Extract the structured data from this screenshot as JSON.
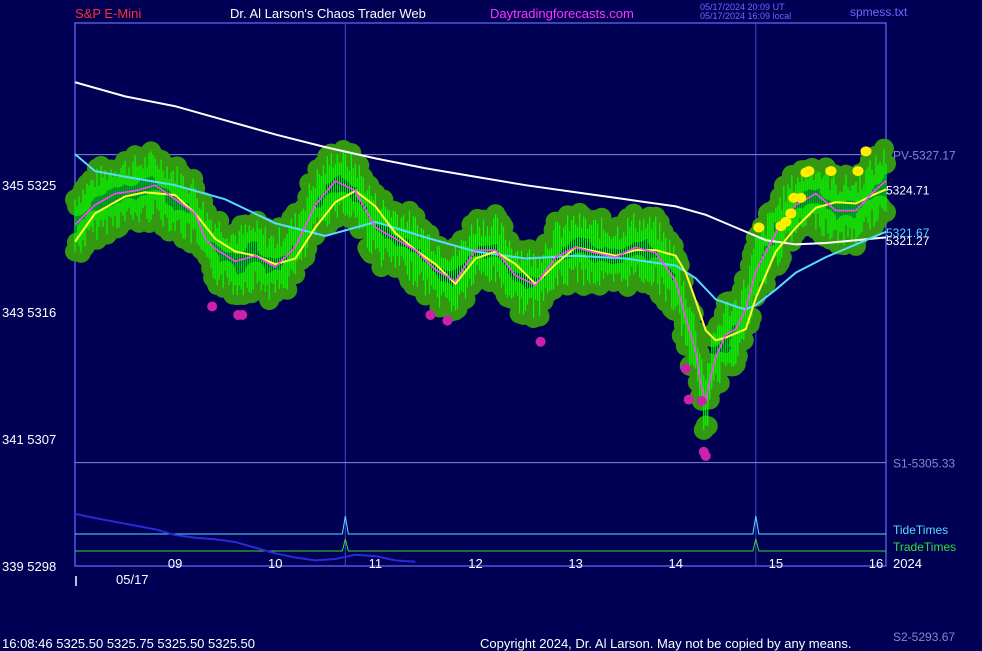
{
  "header": {
    "symbol": "S&P E-Mini",
    "site_title": "Dr. Al Larson's Chaos Trader Web",
    "site_url": "Daytradingforecasts.com",
    "timestamp_ut": "05/17/2024 20:09 UT",
    "timestamp_local": "05/17/2024 16:09 local",
    "file": "spmess.txt"
  },
  "footer": {
    "quote": "16:08:46  5325.50 5325.75 5325.50 5325.50",
    "copyright": "Copyright 2024, Dr. Al Larson. May not be copied by any means.",
    "s2_label": "S2-5293.67"
  },
  "date_label": "05/17",
  "year_label": "2024",
  "chart_data": {
    "type": "line",
    "y_axis_labels": [
      {
        "text": "345  5325",
        "value": 5325
      },
      {
        "text": "343  5316",
        "value": 5316
      },
      {
        "text": "341  5307",
        "value": 5307
      },
      {
        "text": "339  5298",
        "value": 5298
      }
    ],
    "x_ticks": [
      "09",
      "10",
      "11",
      "12",
      "13",
      "14",
      "15",
      "16"
    ],
    "x_tick_values": [
      9,
      10,
      11,
      12,
      13,
      14,
      15,
      16
    ],
    "xlim": [
      8.0,
      16.1
    ],
    "ylim": [
      5298,
      5336.5
    ],
    "levels": [
      {
        "label": "PV-5327.17",
        "value": 5327.17,
        "color": "#8888cc"
      },
      {
        "label": "S1-5305.33",
        "value": 5305.33,
        "color": "#8888cc"
      }
    ],
    "right_labels": [
      {
        "text": "5324.71",
        "value": 5324.71,
        "color": "#ffffff"
      },
      {
        "text": "5321.67",
        "value": 5321.67,
        "color": "#55ddff"
      },
      {
        "text": "5321.27",
        "value": 5321.27,
        "color": "#ffffff"
      }
    ],
    "timing_lines": [
      {
        "label": "TideTimes",
        "color": "#55ddff",
        "peaks": [
          10.7,
          14.8
        ]
      },
      {
        "label": "TradeTimes",
        "color": "#33dd33",
        "peaks": [
          10.7,
          14.8
        ]
      }
    ],
    "vertical_markers": [
      10.7,
      14.8
    ],
    "series": [
      {
        "color": "#ffffff",
        "x": [
          8.0,
          8.5,
          9.0,
          9.5,
          10.0,
          10.5,
          11.0,
          11.5,
          12.0,
          12.5,
          13.0,
          13.5,
          14.0,
          14.3,
          14.6,
          14.9,
          15.2,
          15.5,
          15.8,
          16.1
        ],
        "y": [
          5332.3,
          5331.3,
          5330.6,
          5329.6,
          5328.6,
          5327.7,
          5326.9,
          5326.2,
          5325.6,
          5325.0,
          5324.5,
          5324.0,
          5323.5,
          5322.9,
          5322.0,
          5321.1,
          5320.8,
          5320.9,
          5321.1,
          5321.3
        ]
      },
      {
        "color": "#55ddff",
        "x": [
          8.0,
          8.2,
          8.5,
          9.0,
          9.5,
          10.0,
          10.5,
          11.0,
          11.5,
          12.0,
          12.5,
          13.0,
          13.5,
          14.0,
          14.2,
          14.4,
          14.6,
          14.7,
          14.8,
          15.0,
          15.2,
          15.5,
          15.8,
          16.0,
          16.1
        ],
        "y": [
          5327.2,
          5326.0,
          5325.6,
          5325.0,
          5324.0,
          5322.3,
          5321.4,
          5322.4,
          5321.3,
          5320.3,
          5319.8,
          5320.0,
          5319.8,
          5319.3,
          5318.4,
          5316.9,
          5316.4,
          5316.2,
          5316.5,
          5317.6,
          5318.8,
          5319.9,
          5320.8,
          5321.4,
          5321.7
        ]
      },
      {
        "color": "#ffff33",
        "x": [
          8.0,
          8.2,
          8.5,
          8.7,
          9.0,
          9.2,
          9.4,
          9.6,
          9.8,
          10.0,
          10.2,
          10.4,
          10.6,
          10.8,
          11.0,
          11.2,
          11.4,
          11.6,
          11.8,
          12.0,
          12.2,
          12.4,
          12.6,
          12.8,
          13.0,
          13.2,
          13.4,
          13.6,
          13.8,
          14.0,
          14.1,
          14.2,
          14.3,
          14.4,
          14.5,
          14.6,
          14.7,
          14.8,
          15.0,
          15.2,
          15.4,
          15.6,
          15.8,
          16.0,
          16.1
        ],
        "y": [
          5321.0,
          5323.0,
          5324.2,
          5324.5,
          5324.3,
          5323.0,
          5321.2,
          5320.3,
          5320.0,
          5319.4,
          5319.8,
          5322.0,
          5323.8,
          5324.6,
          5323.5,
          5321.6,
          5320.4,
          5319.4,
          5318.0,
          5319.8,
          5320.3,
          5319.4,
          5318.0,
          5319.4,
          5320.6,
          5320.3,
          5320.0,
          5320.4,
          5320.4,
          5320.0,
          5318.8,
          5316.8,
          5314.7,
          5314.0,
          5314.2,
          5314.5,
          5314.8,
          5317.0,
          5320.3,
          5322.0,
          5323.4,
          5323.8,
          5323.7,
          5324.4,
          5324.7
        ]
      },
      {
        "color": "#ff44ff",
        "x": [
          8.0,
          8.2,
          8.4,
          8.6,
          8.8,
          9.0,
          9.2,
          9.3,
          9.4,
          9.6,
          9.8,
          10.0,
          10.2,
          10.4,
          10.6,
          10.8,
          11.0,
          11.2,
          11.4,
          11.6,
          11.8,
          12.0,
          12.2,
          12.4,
          12.6,
          12.8,
          13.0,
          13.2,
          13.4,
          13.6,
          13.8,
          14.0,
          14.1,
          14.2,
          14.25,
          14.3,
          14.35,
          14.4,
          14.5,
          14.6,
          14.7,
          14.8,
          15.0,
          15.2,
          15.4,
          15.6,
          15.8,
          16.0,
          16.1
        ],
        "y": [
          5322.2,
          5323.6,
          5324.4,
          5324.6,
          5325.0,
          5324.0,
          5323.0,
          5321.2,
          5320.5,
          5319.6,
          5320.0,
          5319.2,
          5320.6,
          5323.6,
          5325.3,
          5324.6,
          5322.0,
          5321.2,
          5320.4,
          5319.0,
          5318.2,
          5320.4,
          5320.4,
          5318.6,
          5317.9,
          5319.9,
          5320.6,
          5320.2,
          5319.9,
          5320.6,
          5320.2,
          5318.2,
          5315.6,
          5313.2,
          5311.0,
          5309.6,
          5311.4,
          5312.8,
          5314.4,
          5314.8,
          5316.2,
          5318.9,
          5321.6,
          5323.6,
          5324.4,
          5323.2,
          5323.2,
          5324.7,
          5325.3
        ]
      },
      {
        "color": "#2a2ad8",
        "x": [
          8.0,
          8.2,
          8.5,
          8.8,
          9.0,
          9.2,
          9.4,
          9.6,
          9.8,
          10.0,
          10.2,
          10.4,
          10.6,
          10.8,
          11.0,
          11.2,
          11.4
        ],
        "y": [
          5301.7,
          5301.4,
          5301.0,
          5300.6,
          5300.2,
          5300.0,
          5299.9,
          5299.7,
          5299.3,
          5298.9,
          5298.6,
          5298.4,
          5298.5,
          5298.8,
          5298.7,
          5298.4,
          5298.3
        ]
      }
    ],
    "markers": [
      {
        "kind": "low",
        "color": "#cc22aa",
        "x": 9.37,
        "y": 5316.4
      },
      {
        "kind": "low",
        "color": "#cc22aa",
        "x": 9.63,
        "y": 5315.8
      },
      {
        "kind": "low",
        "color": "#cc22aa",
        "x": 9.67,
        "y": 5315.8
      },
      {
        "kind": "low",
        "color": "#cc22aa",
        "x": 11.55,
        "y": 5315.8
      },
      {
        "kind": "low",
        "color": "#cc22aa",
        "x": 11.72,
        "y": 5315.4
      },
      {
        "kind": "low",
        "color": "#cc22aa",
        "x": 12.65,
        "y": 5313.9
      },
      {
        "kind": "low",
        "color": "#cc22aa",
        "x": 14.1,
        "y": 5312.0
      },
      {
        "kind": "low",
        "color": "#cc22aa",
        "x": 14.13,
        "y": 5309.8
      },
      {
        "kind": "low",
        "color": "#cc22aa",
        "x": 14.26,
        "y": 5309.7
      },
      {
        "kind": "low",
        "color": "#cc22aa",
        "x": 14.28,
        "y": 5306.1
      },
      {
        "kind": "low",
        "color": "#cc22aa",
        "x": 14.3,
        "y": 5305.8
      },
      {
        "kind": "high",
        "color": "#ffee00",
        "x": 14.83,
        "y": 5322.0
      },
      {
        "kind": "high",
        "color": "#ffee00",
        "x": 15.05,
        "y": 5322.1
      },
      {
        "kind": "high",
        "color": "#ffee00",
        "x": 15.1,
        "y": 5322.4
      },
      {
        "kind": "high",
        "color": "#ffee00",
        "x": 15.15,
        "y": 5323.0
      },
      {
        "kind": "high",
        "color": "#ffee00",
        "x": 15.18,
        "y": 5324.1
      },
      {
        "kind": "high",
        "color": "#ffee00",
        "x": 15.25,
        "y": 5324.1
      },
      {
        "kind": "high",
        "color": "#ffee00",
        "x": 15.3,
        "y": 5325.9
      },
      {
        "kind": "high",
        "color": "#ffee00",
        "x": 15.33,
        "y": 5326.0
      },
      {
        "kind": "high",
        "color": "#ffee00",
        "x": 15.55,
        "y": 5326.0
      },
      {
        "kind": "high",
        "color": "#ffee00",
        "x": 15.82,
        "y": 5326.0
      },
      {
        "kind": "high",
        "color": "#ffee00",
        "x": 15.9,
        "y": 5327.4
      }
    ]
  },
  "colors": {
    "background": "#000055",
    "plot_border": "#6a6aff",
    "price_bars": "#00ff00",
    "price_halo": "#339911"
  }
}
